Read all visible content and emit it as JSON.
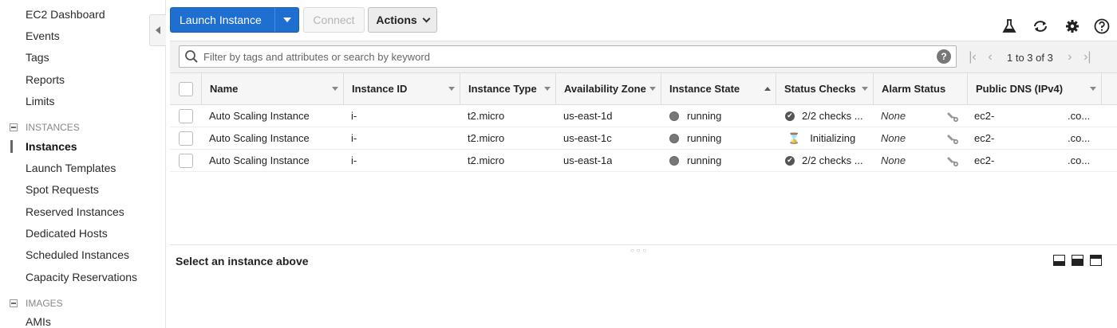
{
  "sidebar": {
    "items_top": [
      "EC2 Dashboard",
      "Events",
      "Tags",
      "Reports",
      "Limits"
    ],
    "section_instances": "INSTANCES",
    "instances_items": [
      "Instances",
      "Launch Templates",
      "Spot Requests",
      "Reserved Instances",
      "Dedicated Hosts",
      "Scheduled Instances",
      "Capacity Reservations"
    ],
    "active_item": "Instances",
    "section_images": "IMAGES",
    "images_items": [
      "AMIs"
    ]
  },
  "toolbar": {
    "launch_label": "Launch Instance",
    "connect_label": "Connect",
    "actions_label": "Actions",
    "icons": [
      "flask-icon",
      "refresh-icon",
      "gear-icon",
      "help-icon"
    ]
  },
  "search": {
    "placeholder": "Filter by tags and attributes or search by keyword"
  },
  "pagination": {
    "text": "1 to 3 of 3"
  },
  "table": {
    "columns": [
      "Name",
      "Instance ID",
      "Instance Type",
      "Availability Zone",
      "Instance State",
      "Status Checks",
      "Alarm Status",
      "Public DNS (IPv4)"
    ],
    "rows": [
      {
        "name": "Auto Scaling Instance",
        "instance_id": "i-",
        "type": "t2.micro",
        "zone": "us-east-1d",
        "state": "running",
        "status": "2/2 checks ...",
        "status_icon": "check-circle-icon",
        "alarm": "None",
        "dns_prefix": "ec2-",
        "dns_suffix": ".co..."
      },
      {
        "name": "Auto Scaling Instance",
        "instance_id": "i-",
        "type": "t2.micro",
        "zone": "us-east-1c",
        "state": "running",
        "status": "Initializing",
        "status_icon": "hourglass-icon",
        "alarm": "None",
        "dns_prefix": "ec2-",
        "dns_suffix": ".co..."
      },
      {
        "name": "Auto Scaling Instance",
        "instance_id": "i-",
        "type": "t2.micro",
        "zone": "us-east-1a",
        "state": "running",
        "status": "2/2 checks ...",
        "status_icon": "check-circle-icon",
        "alarm": "None",
        "dns_prefix": "ec2-",
        "dns_suffix": ".co..."
      }
    ]
  },
  "details": {
    "title": "Select an instance above"
  }
}
